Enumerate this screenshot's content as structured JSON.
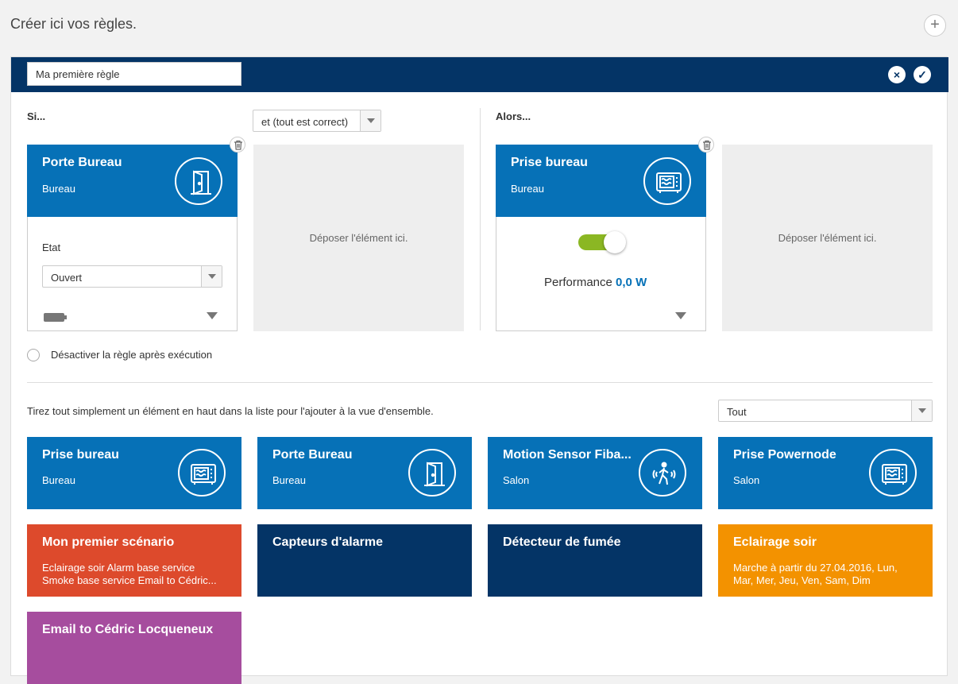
{
  "page": {
    "title": "Créer ici vos règles.",
    "add_label": "+"
  },
  "rule": {
    "name_value": "Ma première règle",
    "cancel_label": "×",
    "confirm_label": "✓",
    "if_label": "Si...",
    "then_label": "Alors...",
    "condition_mode": "et (tout est correct)",
    "drop_zone_label": "Déposer l'élément ici.",
    "disable_after_label": "Désactiver la règle après exécution",
    "condition_card": {
      "title": "Porte Bureau",
      "room": "Bureau",
      "icon": "door-icon",
      "field_label": "Etat",
      "field_value": "Ouvert"
    },
    "action_card": {
      "title": "Prise bureau",
      "room": "Bureau",
      "icon": "microwave-icon",
      "toggle_on": true,
      "performance_label": "Performance",
      "performance_value": "0,0 W"
    }
  },
  "library": {
    "hint": "Tirez tout simplement un élément en haut dans la liste pour l'ajouter à la vue d'ensemble.",
    "filter_value": "Tout",
    "devices": [
      {
        "title": "Prise bureau",
        "room": "Bureau",
        "icon": "microwave-icon"
      },
      {
        "title": "Porte Bureau",
        "room": "Bureau",
        "icon": "door-icon"
      },
      {
        "title": "Motion Sensor Fiba...",
        "room": "Salon",
        "icon": "motion-icon"
      },
      {
        "title": "Prise Powernode",
        "room": "Salon",
        "icon": "microwave-icon"
      }
    ],
    "items": [
      {
        "title": "Mon premier scénario",
        "desc": "Eclairage soir Alarm base service Smoke base service Email to Cédric...",
        "color": "#dd4a2c"
      },
      {
        "title": "Capteurs d'alarme",
        "desc": "",
        "color": "#043466"
      },
      {
        "title": "Détecteur de fumée",
        "desc": "",
        "color": "#043466"
      },
      {
        "title": "Eclairage soir",
        "desc": "Marche à partir du 27.04.2016, Lun, Mar, Mer, Jeu, Ven, Sam, Dim",
        "color": "#f39200"
      },
      {
        "title": "Email to Cédric Locqueneux",
        "desc": "",
        "color": "#a64d9e"
      }
    ]
  },
  "colors": {
    "header": "#043466",
    "device": "#0671b7",
    "toggle": "#8bb723"
  }
}
